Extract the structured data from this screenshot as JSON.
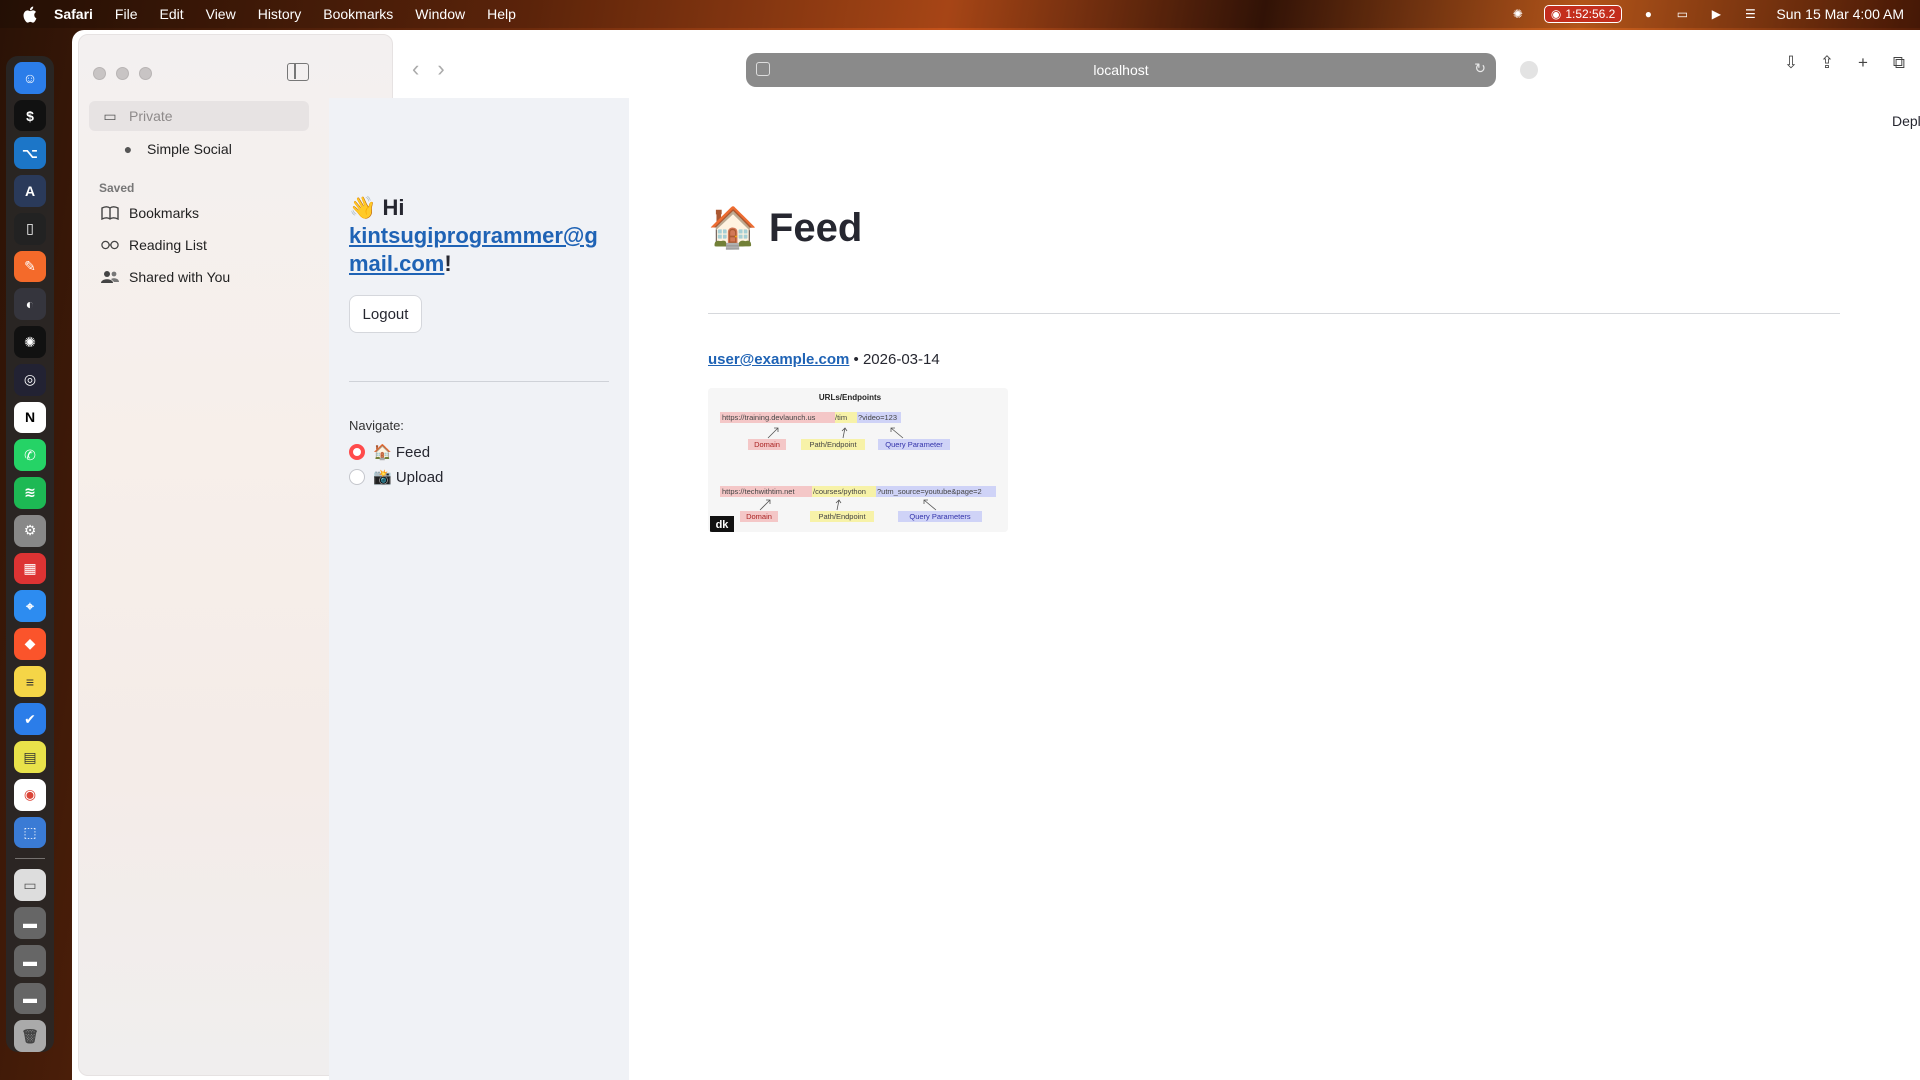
{
  "menubar": {
    "app": "Safari",
    "items": [
      "File",
      "Edit",
      "View",
      "History",
      "Bookmarks",
      "Window",
      "Help"
    ],
    "timer": "1:52:56.2",
    "datetime": "Sun 15 Mar  4:00 AM"
  },
  "browser": {
    "url": "localhost",
    "sidebar": {
      "private": "Private",
      "tab": "Simple Social",
      "saved_header": "Saved",
      "bookmarks": "Bookmarks",
      "reading_list": "Reading List",
      "shared": "Shared with You"
    }
  },
  "app": {
    "greeting_prefix": "👋 Hi",
    "user_email": "kintsugiprogrammer@gmail.com",
    "greeting_suffix": "!",
    "logout_label": "Logout",
    "nav_label": "Navigate:",
    "nav_options": [
      {
        "label": "🏠 Feed",
        "selected": true
      },
      {
        "label": "📸 Upload",
        "selected": false
      }
    ],
    "deploy_label": "Deploy",
    "page_title": "🏠 Feed",
    "posts": [
      {
        "author": "user@example.com",
        "date": "• 2026-03-14"
      }
    ]
  },
  "image": {
    "title": "URLs/Endpoints",
    "url1_domain": "https://training.devlaunch.us",
    "url1_path": "/tim",
    "url1_query": "?video=123",
    "url2_domain": "https://techwithtim.net",
    "url2_path": "/courses/python",
    "url2_query": "?utm_source=youtube&page=2",
    "label_domain": "Domain",
    "label_path": "Path/Endpoint",
    "label_query": "Query Parameter",
    "label_query_plural": "Query Parameters",
    "corner_mark": "dk"
  },
  "colors": {
    "accent_red": "#ff4b4b",
    "link_blue": "#1f63b5",
    "sidebar_bg": "#f0f2f6"
  }
}
